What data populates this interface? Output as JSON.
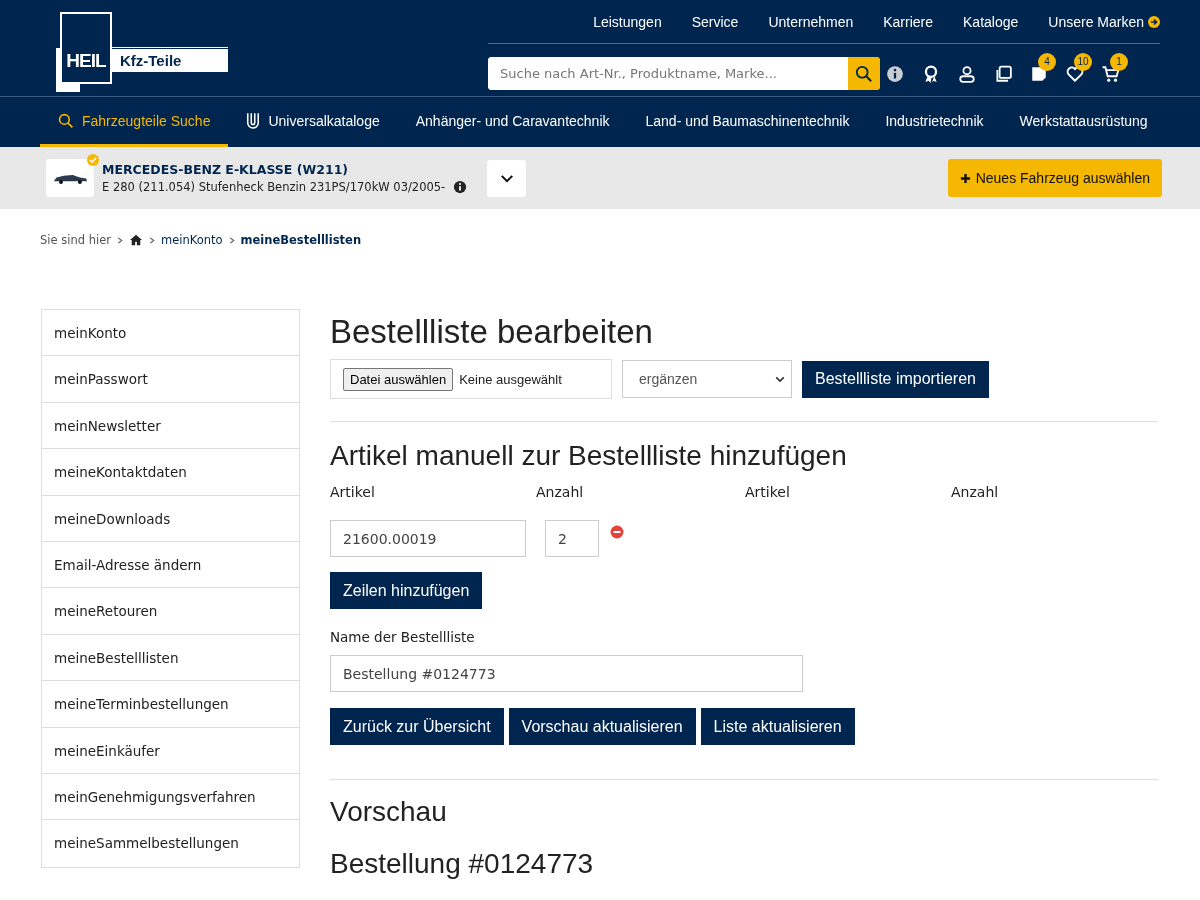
{
  "logo": {
    "left": "HEIL",
    "right": "Kfz-Teile"
  },
  "top_nav": [
    "Leistungen",
    "Service",
    "Unternehmen",
    "Karriere",
    "Kataloge",
    "Unsere Marken"
  ],
  "search": {
    "placeholder": "Suche nach Art-Nr., Produktname, Marke..."
  },
  "header_icons": [
    {
      "kind": "info"
    },
    {
      "kind": "award"
    },
    {
      "kind": "user"
    },
    {
      "kind": "copy"
    },
    {
      "kind": "note",
      "badge": "4"
    },
    {
      "kind": "heart",
      "badge": "10"
    },
    {
      "kind": "cart",
      "badge": "1"
    }
  ],
  "main_nav": [
    {
      "label": "Fahrzeugteile Suche",
      "kind": "search",
      "selected": true
    },
    {
      "label": "Universalkataloge",
      "kind": "u",
      "selected": false
    },
    {
      "label": "Anhänger- und Caravantechnik",
      "kind": "plain",
      "selected": false
    },
    {
      "label": "Land- und Baumaschinentechnik",
      "kind": "plain",
      "selected": false
    },
    {
      "label": "Industrietechnik",
      "kind": "plain",
      "selected": false
    },
    {
      "label": "Werkstattausrüstung",
      "kind": "plain",
      "selected": false
    }
  ],
  "vehicle": {
    "name": "MERCEDES-BENZ E-KLASSE (W211)",
    "details": "E 280 (211.054) Stufenheck Benzin 231PS/170kW 03/2005-",
    "verified": true,
    "button": "Neues Fahrzeug auswählen"
  },
  "breadcrumb": {
    "prefix": "Sie sind hier",
    "items": [
      "meinKonto",
      "meineBestelllisten"
    ]
  },
  "sidebar": {
    "items": [
      "meinKonto",
      "meinPasswort",
      "meinNewsletter",
      "meineKontaktdaten",
      "meineDownloads",
      "Email-Adresse ändern",
      "meineRetouren",
      "meineBestelllisten",
      "meineTerminbestellungen",
      "meineEinkäufer",
      "meinGenehmigungsverfahren",
      "meineSammelbestellungen"
    ]
  },
  "page_title": "Bestellliste bearbeiten",
  "import": {
    "file_button": "Datei auswählen",
    "file_status": "Keine ausgewählt",
    "mode": "ergänzen",
    "submit": "Bestellliste importieren"
  },
  "manual": {
    "title": "Artikel manuell zur Bestellliste hinzufügen",
    "columns": [
      "Artikel",
      "Anzahl",
      "Artikel",
      "Anzahl"
    ],
    "rows": [
      {
        "article": "21600.00019",
        "quantity": "2"
      }
    ],
    "add_rows": "Zeilen hinzufügen"
  },
  "list_name": {
    "label": "Name der Bestellliste",
    "value": "Bestellung #0124773"
  },
  "actions": [
    "Zurück zur Übersicht",
    "Vorschau aktualisieren",
    "Liste aktualisieren"
  ],
  "preview": {
    "title": "Vorschau",
    "list_title": "Bestellung #0124773"
  }
}
